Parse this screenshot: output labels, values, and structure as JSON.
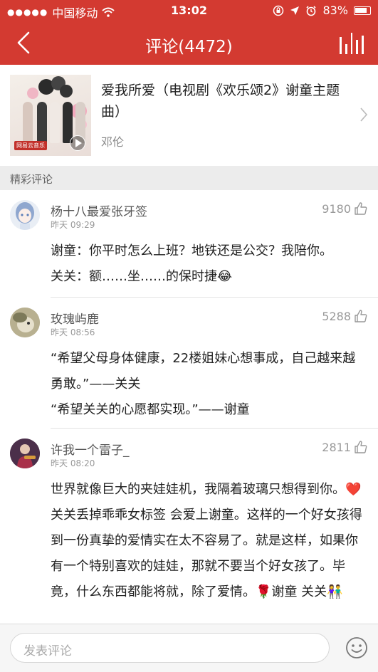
{
  "status_bar": {
    "carrier": "中国移动",
    "time": "13:02",
    "battery": "83%"
  },
  "nav": {
    "title": "评论(4472)"
  },
  "song": {
    "title": "爱我所爱（电视剧《欢乐颂2》谢童主题曲）",
    "artist": "邓伦",
    "cover_logo": "网易云音乐"
  },
  "section_label": "精彩评论",
  "comments": [
    {
      "user": "杨十八最爱张牙签",
      "time": "昨天 09:29",
      "likes": "9180",
      "text": "谢童：你平时怎么上班？地铁还是公交？我陪你。\n关关：额……坐……的保时捷😂"
    },
    {
      "user": "玫瑰屿鹿",
      "time": "昨天 08:56",
      "likes": "5288",
      "text": "“希望父母身体健康，22楼姐妹心想事成，自己越来越勇敢。”——关关\n“希望关关的心愿都实现。”——谢童"
    },
    {
      "user": "许我一个雷子_",
      "time": "昨天 08:20",
      "likes": "2811",
      "text": "世界就像巨大的夹娃娃机，我隔着玻璃只想得到你。❤️关关丢掉乖乖女标签 会爱上谢童。这样的一个好女孩得到一份真挚的爱情实在太不容易了。就是这样，如果你有一个特别喜欢的娃娃，那就不要当个好女孩了。毕竟，什么东西都能将就，除了爱情。🌹谢童 关关👫"
    }
  ],
  "comment_input": {
    "placeholder": "发表评论"
  },
  "colors": {
    "brand_red": "#d33a31"
  }
}
